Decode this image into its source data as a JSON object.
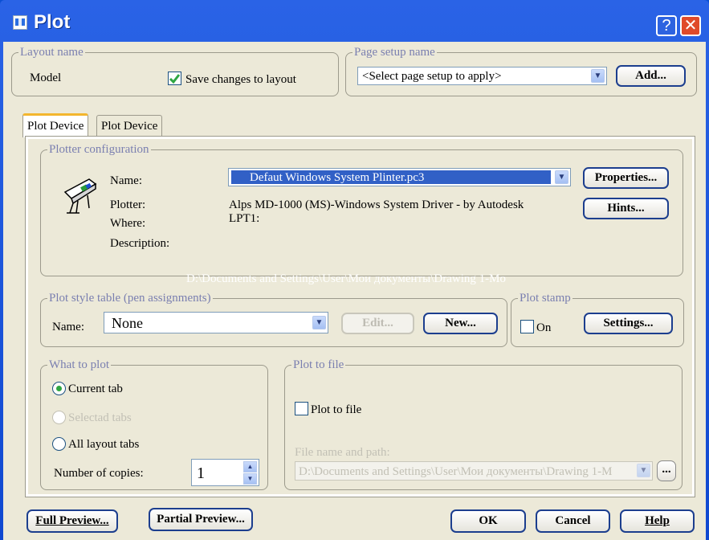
{
  "window": {
    "title": "Plot",
    "help_glyph": "?",
    "close_glyph": "✕"
  },
  "layout_name": {
    "group_label": "Layout name",
    "value": "Model",
    "save_changes_label": "Save changes to layout",
    "save_changes_checked": true
  },
  "page_setup": {
    "group_label": "Page setup name",
    "selected": "<Select page setup to apply>",
    "add_button": "Add..."
  },
  "tabs": [
    {
      "label": "Plot Device",
      "active": true
    },
    {
      "label": "Plot Device",
      "active": false
    }
  ],
  "plotter": {
    "group_label": "Plotter configuration",
    "name_label": "Name:",
    "name_value": "Defaut Windows System Plinter.pc3",
    "plotter_label": "Plotter:",
    "plotter_value": "Alps MD-1000 (MS)-Windows System Driver - by Autodesk",
    "where_label": "Where:",
    "where_value": "LPT1:",
    "description_label": "Description:",
    "properties_button": "Properties...",
    "hints_button": "Hints...",
    "path_text": "D:\\Documents and Settings\\User\\Мои документы\\Drawing 1-Mo"
  },
  "plot_style": {
    "group_label": "Plot style table (pen assignments)",
    "name_label": "Name:",
    "name_value": "None",
    "edit_button": "Edit...",
    "new_button": "New..."
  },
  "plot_stamp": {
    "group_label": "Plot stamp",
    "on_label": "On",
    "on_checked": false,
    "settings_button": "Settings..."
  },
  "what_to_plot": {
    "group_label": "What to plot",
    "options": [
      {
        "label": "Current tab",
        "selected": true,
        "enabled": true
      },
      {
        "label": "Selectad tabs",
        "selected": false,
        "enabled": false
      },
      {
        "label": "All layout tabs",
        "selected": false,
        "enabled": true
      }
    ],
    "copies_label": "Number of copies:",
    "copies_value": "1"
  },
  "plot_to_file": {
    "group_label": "Plot to file",
    "checkbox_label": "Plot to file",
    "checked": false,
    "path_label": "File name and path:",
    "path_value": "D:\\Documents and Settings\\User\\Мои документы\\Drawing 1-M",
    "browse_button": "..."
  },
  "footer": {
    "full_preview": "Full Preview...",
    "partial_preview": "Partial Preview...",
    "ok": "OK",
    "cancel": "Cancel",
    "help": "Help"
  }
}
